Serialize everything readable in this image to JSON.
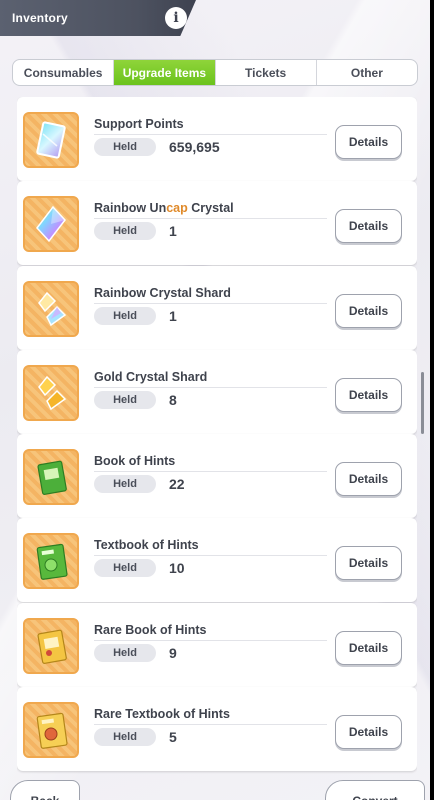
{
  "header": {
    "title": "Inventory",
    "info_label": "i"
  },
  "tabs": [
    {
      "label": "Consumables",
      "active": false
    },
    {
      "label": "Upgrade Items",
      "active": true
    },
    {
      "label": "Tickets",
      "active": false
    },
    {
      "label": "Other",
      "active": false
    }
  ],
  "items": [
    {
      "name": "Support Points",
      "held_label": "Held",
      "held": "659,695",
      "details_label": "Details",
      "icon": "support-points-icon"
    },
    {
      "name_prefix": "Rainbow Un",
      "name_accent": "cap",
      "name_suffix": " Crystal",
      "held_label": "Held",
      "held": "1",
      "details_label": "Details",
      "icon": "rainbow-crystal-icon"
    },
    {
      "name": "Rainbow Crystal Shard",
      "held_label": "Held",
      "held": "1",
      "details_label": "Details",
      "icon": "rainbow-shard-icon"
    },
    {
      "name": "Gold Crystal Shard",
      "held_label": "Held",
      "held": "8",
      "details_label": "Details",
      "icon": "gold-shard-icon"
    },
    {
      "name": "Book of Hints",
      "held_label": "Held",
      "held": "22",
      "details_label": "Details",
      "icon": "book-icon"
    },
    {
      "name": "Textbook of Hints",
      "held_label": "Held",
      "held": "10",
      "details_label": "Details",
      "icon": "textbook-icon"
    },
    {
      "name": "Rare Book of Hints",
      "held_label": "Held",
      "held": "9",
      "details_label": "Details",
      "icon": "rare-book-icon"
    },
    {
      "name": "Rare Textbook of Hints",
      "held_label": "Held",
      "held": "5",
      "details_label": "Details",
      "icon": "rare-textbook-icon"
    }
  ],
  "footer": {
    "back_label": "Back",
    "convert_label": "Convert"
  },
  "colors": {
    "active_tab": "#6bc31c",
    "accent_text": "#e08a2a",
    "header_bg": "#4d5260"
  }
}
